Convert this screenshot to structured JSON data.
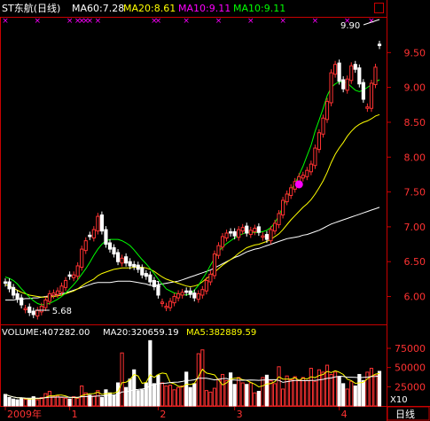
{
  "header": {
    "title": "ST东航(日线)",
    "indicators": [
      {
        "label": "MA60:7.28",
        "color": "#ffffff"
      },
      {
        "label": "MA20:8.61",
        "color": "#ffff00"
      },
      {
        "label": "MA10:9.11",
        "color": "#ff00ff"
      },
      {
        "label": "MA10:9.11",
        "color": "#00ff00"
      }
    ]
  },
  "volume_header": {
    "indicators": [
      {
        "label": "VOLUME:407282.00",
        "color": "#ffffff"
      },
      {
        "label": "MA20:320659.19",
        "color": "#ffffff"
      },
      {
        "label": "MA5:382889.59",
        "color": "#ffff00"
      }
    ]
  },
  "annotations": {
    "high": "9.90",
    "low": "5.68",
    "marker": "1"
  },
  "volume_unit": "X10",
  "period_button": "日线",
  "colors": {
    "up": "#ff3232",
    "down": "#ffffff",
    "frame": "#c80000",
    "axis_text": "#ff3232"
  },
  "chart_data": {
    "type": "candlestick",
    "price_axis": {
      "ticks": [
        6.0,
        6.5,
        7.0,
        7.5,
        8.0,
        8.5,
        9.0,
        9.5
      ],
      "ylim": [
        5.6,
        10.0
      ]
    },
    "volume_axis": {
      "ticks": [
        25000,
        50000,
        75000
      ],
      "ylim": [
        0,
        90000
      ]
    },
    "x_labels": [
      "2009年",
      "1",
      "2",
      "3",
      "4"
    ],
    "x_label_index": [
      0,
      16,
      38,
      57,
      83
    ],
    "close": [
      6.19,
      6.11,
      6.02,
      5.96,
      5.88,
      5.83,
      5.77,
      5.74,
      5.8,
      5.86,
      5.95,
      6.04,
      6.05,
      6.08,
      6.15,
      6.23,
      6.29,
      6.31,
      6.44,
      6.68,
      6.8,
      6.86,
      6.96,
      7.15,
      6.94,
      6.75,
      6.68,
      6.61,
      6.5,
      6.55,
      6.48,
      6.44,
      6.43,
      6.39,
      6.31,
      6.29,
      6.21,
      6.14,
      6.02,
      5.92,
      5.86,
      5.93,
      6.0,
      6.04,
      6.06,
      6.06,
      6.03,
      5.98,
      6.04,
      6.1,
      6.23,
      6.32,
      6.61,
      6.73,
      6.86,
      6.91,
      6.91,
      6.87,
      6.96,
      6.99,
      6.91,
      6.95,
      6.98,
      6.92,
      6.87,
      6.82,
      6.96,
      7.05,
      7.19,
      7.38,
      7.47,
      7.56,
      7.65,
      7.72,
      7.74,
      7.81,
      7.9,
      8.13,
      8.35,
      8.56,
      8.8,
      9.21,
      9.33,
      9.09,
      8.98,
      9.12,
      9.31,
      9.26,
      9.05,
      8.83,
      8.72,
      9.06,
      9.29,
      9.6
    ],
    "candle_color": [
      "down",
      "down",
      "down",
      "down",
      "down",
      "up",
      "down",
      "down",
      "up",
      "up",
      "up",
      "up",
      "up",
      "up",
      "up",
      "up",
      "down",
      "up",
      "up",
      "up",
      "up",
      "down",
      "up",
      "up",
      "down",
      "down",
      "down",
      "down",
      "down",
      "up",
      "down",
      "down",
      "down",
      "down",
      "down",
      "down",
      "down",
      "down",
      "down",
      "up",
      "up",
      "up",
      "up",
      "up",
      "up",
      "down",
      "down",
      "down",
      "up",
      "up",
      "up",
      "up",
      "up",
      "up",
      "up",
      "up",
      "down",
      "down",
      "up",
      "up",
      "down",
      "up",
      "up",
      "down",
      "up",
      "down",
      "up",
      "up",
      "up",
      "up",
      "up",
      "up",
      "up",
      "up",
      "up",
      "up",
      "up",
      "up",
      "up",
      "up",
      "up",
      "up",
      "up",
      "down",
      "down",
      "up",
      "up",
      "down",
      "down",
      "down",
      "up",
      "up",
      "up",
      "down"
    ],
    "volume": [
      15000,
      11000,
      9000,
      8000,
      10000,
      8500,
      9000,
      12000,
      8000,
      11000,
      16000,
      19000,
      12000,
      13000,
      11000,
      10000,
      9000,
      12000,
      10000,
      26000,
      17000,
      14000,
      13000,
      20000,
      11000,
      21000,
      17000,
      14000,
      30000,
      69000,
      24000,
      35000,
      47000,
      20000,
      21000,
      30000,
      85000,
      29000,
      40000,
      30000,
      26000,
      27000,
      21000,
      24000,
      26000,
      44000,
      24000,
      29000,
      68000,
      73000,
      20000,
      18000,
      23000,
      35000,
      41000,
      33000,
      43000,
      28000,
      37000,
      30000,
      28000,
      30000,
      17000,
      19000,
      37000,
      40000,
      33000,
      29000,
      51000,
      22000,
      39000,
      34000,
      38000,
      33000,
      37000,
      33000,
      49000,
      32000,
      47000,
      44000,
      53000,
      41000,
      44000,
      38000,
      29000,
      22000,
      32000,
      26000,
      41000,
      33000,
      44000,
      49000,
      40000,
      45000
    ],
    "moving_averages": [
      {
        "name": "MA60",
        "color": "#ffffff",
        "values": [
          5.95,
          5.95,
          5.95,
          5.96,
          5.96,
          5.97,
          5.97,
          5.98,
          5.98,
          5.99,
          6.0,
          6.01,
          6.02,
          6.03,
          6.04,
          6.05,
          6.07,
          6.09,
          6.11,
          6.13,
          6.15,
          6.17,
          6.19,
          6.2,
          6.2,
          6.2,
          6.2,
          6.21,
          6.22,
          6.22,
          6.22,
          6.22,
          6.21,
          6.2,
          6.19,
          6.18,
          6.16,
          6.16,
          6.17,
          6.18,
          6.19,
          6.2,
          6.21,
          6.22,
          6.24,
          6.26,
          6.28,
          6.3,
          6.32,
          6.34,
          6.36,
          6.38,
          6.41,
          6.44,
          6.47,
          6.5,
          6.53,
          6.56,
          6.58,
          6.61,
          6.64,
          6.66,
          6.68,
          6.69,
          6.71,
          6.73,
          6.75,
          6.77,
          6.79,
          6.81,
          6.83,
          6.84,
          6.85,
          6.86,
          6.88,
          6.89,
          6.91,
          6.93,
          6.95,
          6.98,
          7.01,
          7.04,
          7.06,
          7.08,
          7.1,
          7.12,
          7.14,
          7.16,
          7.18,
          7.2,
          7.22,
          7.24,
          7.26,
          7.28
        ]
      },
      {
        "name": "MA20",
        "color": "#ffff00",
        "values": [
          6.17,
          6.15,
          6.12,
          6.09,
          6.06,
          6.04,
          6.02,
          6.01,
          6.0,
          5.99,
          5.99,
          5.99,
          6.0,
          6.01,
          6.02,
          6.04,
          6.06,
          6.08,
          6.11,
          6.15,
          6.19,
          6.22,
          6.25,
          6.3,
          6.33,
          6.35,
          6.37,
          6.39,
          6.4,
          6.41,
          6.41,
          6.41,
          6.42,
          6.42,
          6.42,
          6.41,
          6.39,
          6.36,
          6.32,
          6.28,
          6.25,
          6.23,
          6.21,
          6.19,
          6.17,
          6.15,
          6.14,
          6.15,
          6.17,
          6.21,
          6.26,
          6.3,
          6.35,
          6.4,
          6.45,
          6.49,
          6.53,
          6.57,
          6.62,
          6.66,
          6.7,
          6.72,
          6.74,
          6.75,
          6.77,
          6.79,
          6.82,
          6.86,
          6.9,
          6.96,
          7.03,
          7.1,
          7.16,
          7.22,
          7.28,
          7.33,
          7.39,
          7.47,
          7.56,
          7.66,
          7.78,
          7.92,
          8.04,
          8.13,
          8.21,
          8.3,
          8.37,
          8.43,
          8.47,
          8.5,
          8.52,
          8.55,
          8.59,
          8.61
        ]
      },
      {
        "name": "MA10",
        "color": "#00ff00",
        "values": [
          6.28,
          6.26,
          6.23,
          6.18,
          6.11,
          6.05,
          5.99,
          5.94,
          5.9,
          5.88,
          5.89,
          5.9,
          5.93,
          5.96,
          6.0,
          6.05,
          6.11,
          6.17,
          6.24,
          6.32,
          6.4,
          6.49,
          6.59,
          6.68,
          6.75,
          6.8,
          6.82,
          6.82,
          6.82,
          6.8,
          6.77,
          6.73,
          6.67,
          6.6,
          6.53,
          6.47,
          6.4,
          6.33,
          6.25,
          6.18,
          6.11,
          6.08,
          6.05,
          6.04,
          6.03,
          6.02,
          6.04,
          6.09,
          6.16,
          6.25,
          6.34,
          6.45,
          6.55,
          6.64,
          6.71,
          6.76,
          6.8,
          6.84,
          6.87,
          6.9,
          6.92,
          6.92,
          6.92,
          6.92,
          6.93,
          6.95,
          6.99,
          7.06,
          7.16,
          7.29,
          7.41,
          7.53,
          7.62,
          7.74,
          7.87,
          8.02,
          8.17,
          8.37,
          8.53,
          8.7,
          8.88,
          9.0,
          9.05,
          9.08,
          9.08,
          9.06,
          9.01,
          8.96,
          8.94,
          8.96,
          9.0,
          9.04,
          9.08,
          9.11
        ]
      }
    ],
    "marker": {
      "index": 73,
      "value": 7.61,
      "color": "#ff00ff"
    },
    "top_markers_index": [
      0,
      8,
      16,
      18,
      19,
      20,
      21,
      23,
      37,
      38,
      45,
      53,
      61,
      69,
      77,
      85,
      91
    ],
    "annotation_index": {
      "high": 93,
      "low": 7,
      "marker": 38
    }
  }
}
